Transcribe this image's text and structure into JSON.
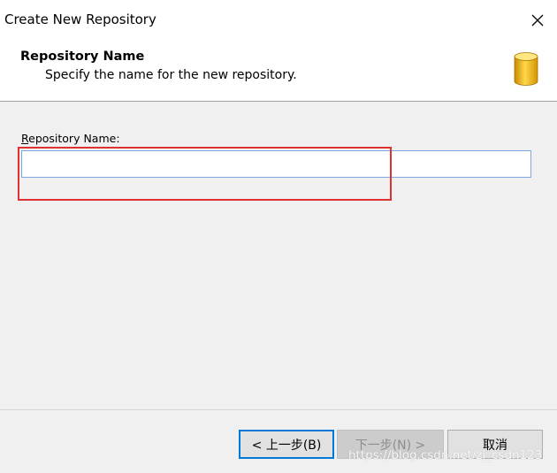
{
  "window": {
    "title": "Create New Repository",
    "close_icon": "close-icon"
  },
  "header": {
    "title": "Repository Name",
    "subtitle": "Specify the name for the new repository.",
    "icon": "database-icon",
    "icon_color": "#f0b400"
  },
  "form": {
    "label_prefix": "R",
    "label_rest": "epository Name:",
    "value": "",
    "placeholder": ""
  },
  "annotation": {
    "color": "#e03030"
  },
  "buttons": {
    "back_label": "< 上一步(B)",
    "next_label": "下一步(N) >",
    "cancel_label": "取消",
    "accent": "#0078d7"
  },
  "watermark": {
    "text": "https://blog.csdn.net/zj_csdn123"
  }
}
